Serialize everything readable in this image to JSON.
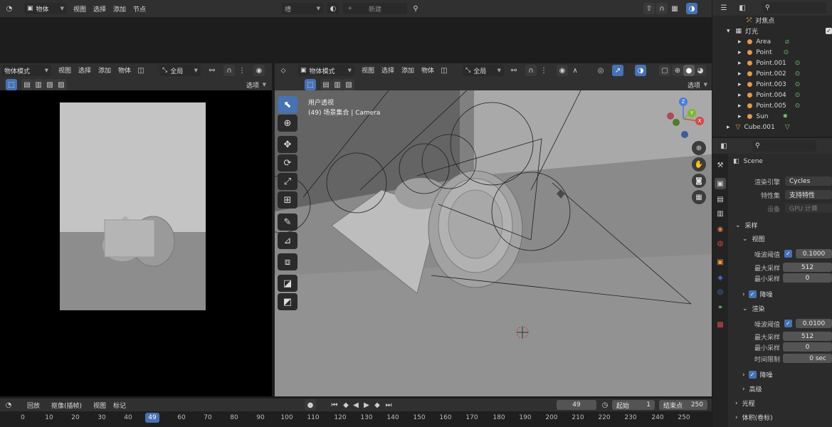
{
  "top_header": {
    "editor_mode": "物体",
    "menu": [
      "视图",
      "选择",
      "添加",
      "节点"
    ],
    "slot_label": "槽",
    "new_label": "新建"
  },
  "outliner": {
    "items": [
      {
        "label": "对焦点",
        "indent": 3
      },
      {
        "label": "灯光",
        "indent": 2
      },
      {
        "label": "Area",
        "indent": 3
      },
      {
        "label": "Point",
        "indent": 3
      },
      {
        "label": "Point.001",
        "indent": 3
      },
      {
        "label": "Point.002",
        "indent": 3
      },
      {
        "label": "Point.003",
        "indent": 3
      },
      {
        "label": "Point.004",
        "indent": 3
      },
      {
        "label": "Point.005",
        "indent": 3
      },
      {
        "label": "Sun",
        "indent": 3
      },
      {
        "label": "Cube.001",
        "indent": 1
      }
    ]
  },
  "left_view": {
    "mode": "物体模式",
    "menu": [
      "视图",
      "选择",
      "添加",
      "物体"
    ],
    "transform": "全局",
    "options": "选项"
  },
  "main_view": {
    "mode": "物体模式",
    "menu": [
      "视图",
      "选择",
      "添加",
      "物体"
    ],
    "transform": "全局",
    "options": "选项",
    "overlay_title": "用户透视",
    "overlay_sub": "(49) 场景集合 | Camera",
    "gizmo": {
      "x": "X",
      "y": "Y",
      "z": "Z"
    }
  },
  "properties": {
    "scene_name": "Scene",
    "render_engine_label": "渲染引擎",
    "render_engine": "Cycles",
    "feature_set_label": "特性集",
    "feature_set": "支持特性",
    "device_label": "设备",
    "device": "GPU 计算",
    "sampling": {
      "title": "采样",
      "viewport": {
        "title": "视图",
        "noise_threshold_label": "噪波阈值",
        "noise_threshold": "0.1000",
        "max_samples_label": "最大采样",
        "max_samples": "512",
        "min_samples_label": "最小采样",
        "min_samples": "0",
        "denoise": "降噪"
      },
      "render": {
        "title": "渲染",
        "noise_threshold_label": "噪波阈值",
        "noise_threshold": "0.0100",
        "max_samples_label": "最大采样",
        "max_samples": "512",
        "min_samples_label": "最小采样",
        "min_samples": "0",
        "time_limit_label": "时间限制",
        "time_limit": "0 sec",
        "denoise": "降噪"
      },
      "advanced": "高级"
    },
    "light_paths": "光程",
    "volumes": "体积(卷标)"
  },
  "timeline": {
    "menu": [
      "回放",
      "抠像(插帧)",
      "视图",
      "标记"
    ],
    "current_frame": "49",
    "start_label": "起始",
    "start": "1",
    "end_label": "结束点",
    "end": "250",
    "ticks": [
      "0",
      "10",
      "20",
      "30",
      "40",
      "49",
      "60",
      "70",
      "80",
      "90",
      "100",
      "110",
      "120",
      "130",
      "140",
      "150",
      "160",
      "170",
      "180",
      "190",
      "200",
      "210",
      "220",
      "230",
      "240",
      "250"
    ]
  },
  "colors": {
    "accent": "#4772b3",
    "panel": "#303030",
    "background": "#1d1d1d",
    "orange": "#e39a4e",
    "green": "#6bc36b"
  }
}
